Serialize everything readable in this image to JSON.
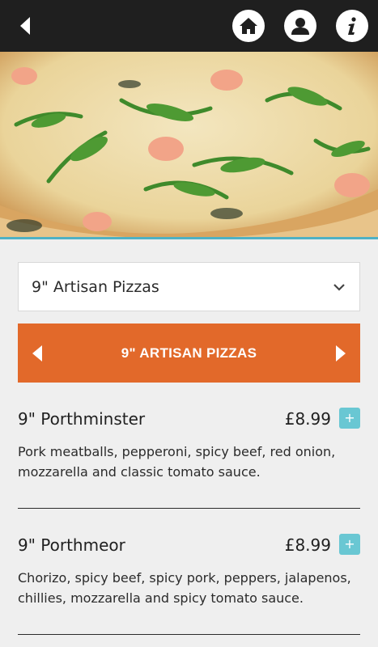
{
  "header": {
    "back_icon": "chevron-left-icon",
    "home_icon": "home-icon",
    "account_icon": "user-icon",
    "info_icon": "info-icon"
  },
  "hero": {
    "image": "pizza-photo",
    "accent_color": "#4fb1c4"
  },
  "category_select": {
    "value": "9\" Artisan Pizzas",
    "icon": "chevron-down-icon"
  },
  "category_bar": {
    "title": "9\" ARTISAN PIZZAS",
    "color": "#e2692a"
  },
  "items": [
    {
      "name": "9\" Porthminster",
      "price": "£8.99",
      "add_label": "+",
      "description": "Pork meatballs, pepperoni, spicy beef, red onion, mozzarella and classic tomato sauce."
    },
    {
      "name": "9\" Porthmeor",
      "price": "£8.99",
      "add_label": "+",
      "description": "Chorizo, spicy beef, spicy pork, peppers, jalapenos, chillies, mozzarella and spicy tomato sauce."
    }
  ]
}
